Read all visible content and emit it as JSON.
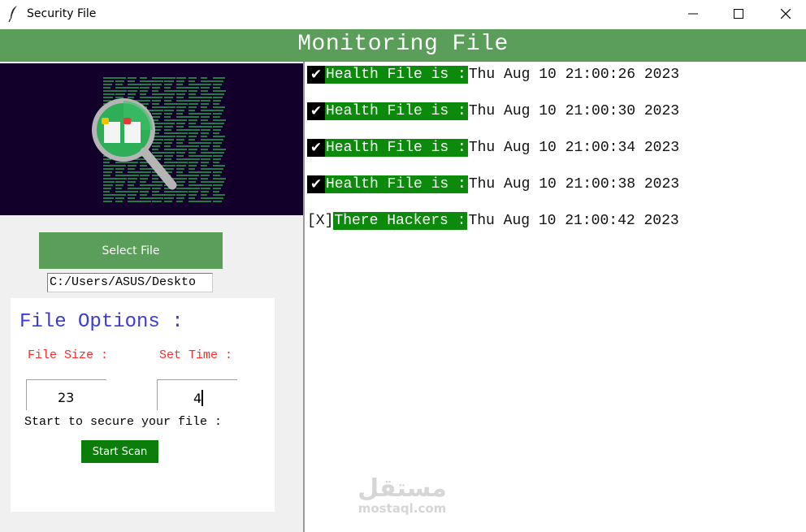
{
  "window": {
    "title": "Security File",
    "icon": "feather-icon",
    "controls": [
      "minimize-icon",
      "maximize-icon",
      "close-icon"
    ]
  },
  "header": {
    "title": "Monitoring File"
  },
  "left_panel": {
    "banner_icon": "magnifier-file-scan-icon",
    "select_button": "Select File",
    "path_value": "C:/Users/ASUS/Deskto",
    "options": {
      "title": "File Options :",
      "file_size_label": "File Size :",
      "set_time_label": "Set Time :",
      "file_size_value": "23",
      "set_time_value": "4",
      "start_text": "Start to secure your file :",
      "scan_button": "Start Scan"
    }
  },
  "log": {
    "entries": [
      {
        "status": "ok",
        "mark": "✔",
        "label": "Health File is : ",
        "time": "Thu Aug 10 21:00:26 2023"
      },
      {
        "status": "ok",
        "mark": "✔",
        "label": "Health File is : ",
        "time": "Thu Aug 10 21:00:30 2023"
      },
      {
        "status": "ok",
        "mark": "✔",
        "label": "Health File is : ",
        "time": "Thu Aug 10 21:00:34 2023"
      },
      {
        "status": "ok",
        "mark": "✔",
        "label": "Health File is : ",
        "time": "Thu Aug 10 21:00:38 2023"
      },
      {
        "status": "alert",
        "mark": "[X]",
        "label": "There Hackers :",
        "time": "Thu Aug 10 21:00:42 2023"
      }
    ]
  },
  "watermark": {
    "arabic": "مستقل",
    "latin": "mostaql.com"
  },
  "colors": {
    "header_green": "#5a9e5a",
    "label_green": "#0b8a0b",
    "scan_button_green": "#0b7d0b",
    "options_title_blue": "#3b3bdb",
    "label_red": "#ff2b2b",
    "banner_bg": "#12002a"
  }
}
